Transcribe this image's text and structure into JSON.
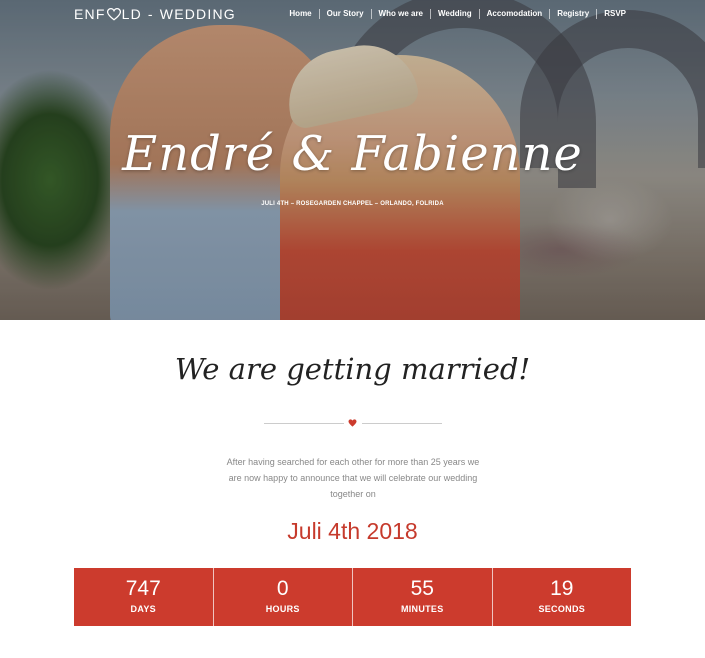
{
  "brand": {
    "part1": "ENF",
    "part2": "LD",
    "sep": "-",
    "part3": "WEDDING"
  },
  "nav": [
    {
      "label": "Home"
    },
    {
      "label": "Our Story"
    },
    {
      "label": "Who we are"
    },
    {
      "label": "Wedding"
    },
    {
      "label": "Accomodation"
    },
    {
      "label": "Registry"
    },
    {
      "label": "RSVP"
    }
  ],
  "hero": {
    "title": "Endré & Fabienne",
    "subtitle": "JULI 4TH – ROSEGARDEN CHAPPEL – ORLANDO, FOLRIDA"
  },
  "section": {
    "heading": "We are getting married!",
    "intro": "After having searched for each other for more than 25 years we are now happy to announce that we will celebrate our wedding together on",
    "date": "Juli 4th 2018"
  },
  "countdown": [
    {
      "value": "747",
      "label": "DAYS"
    },
    {
      "value": "0",
      "label": "HOURS"
    },
    {
      "value": "55",
      "label": "MINUTES"
    },
    {
      "value": "19",
      "label": "SECONDS"
    }
  ],
  "colors": {
    "accent": "#cc3b2d",
    "date": "#c63a2c",
    "text_muted": "#888888"
  },
  "icons": {
    "logo_heart": "heart-outline-icon",
    "divider_heart": "heart-icon"
  }
}
